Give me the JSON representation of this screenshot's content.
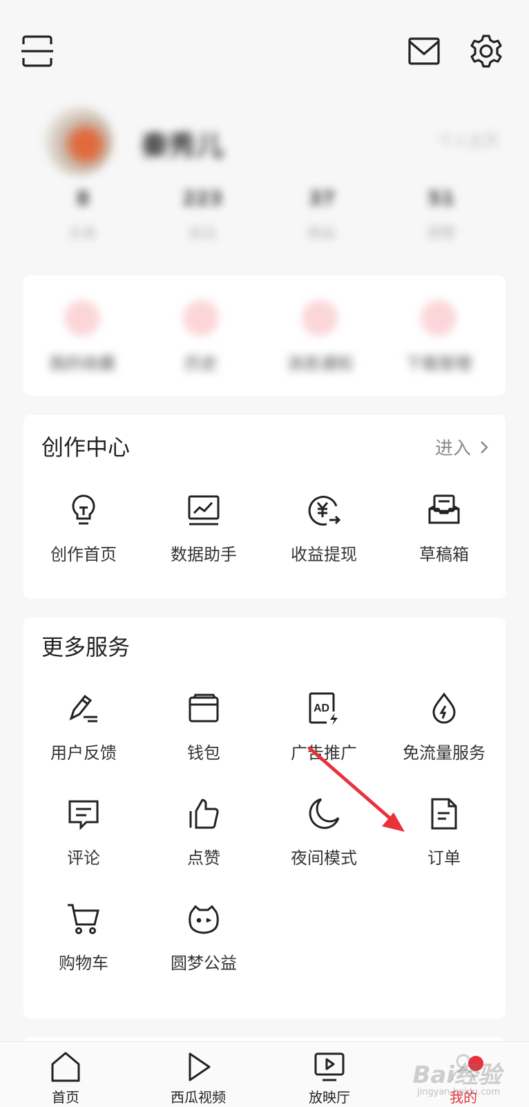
{
  "profile": {
    "name": "秦秀儿",
    "homepage_link": "个人主页",
    "stats": [
      {
        "num": "8",
        "label": "头条"
      },
      {
        "num": "223",
        "label": "关注"
      },
      {
        "num": "37",
        "label": "粉丝"
      },
      {
        "num": "51",
        "label": "获赞"
      }
    ]
  },
  "quick_actions": [
    {
      "label": "我的收藏"
    },
    {
      "label": "历史"
    },
    {
      "label": "消息通知"
    },
    {
      "label": "下载管理"
    }
  ],
  "creation_center": {
    "title": "创作中心",
    "enter_label": "进入",
    "items": [
      {
        "label": "创作首页",
        "icon": "lightbulb-icon"
      },
      {
        "label": "数据助手",
        "icon": "chart-monitor-icon"
      },
      {
        "label": "收益提现",
        "icon": "yuan-withdraw-icon"
      },
      {
        "label": "草稿箱",
        "icon": "drafts-box-icon"
      }
    ]
  },
  "more_services": {
    "title": "更多服务",
    "items": [
      {
        "label": "用户反馈",
        "icon": "pencil-feedback-icon"
      },
      {
        "label": "钱包",
        "icon": "wallet-icon"
      },
      {
        "label": "广告推广",
        "icon": "ad-icon"
      },
      {
        "label": "免流量服务",
        "icon": "water-drop-icon"
      },
      {
        "label": "评论",
        "icon": "comment-icon"
      },
      {
        "label": "点赞",
        "icon": "thumbs-up-icon"
      },
      {
        "label": "夜间模式",
        "icon": "moon-icon"
      },
      {
        "label": "订单",
        "icon": "order-document-icon"
      },
      {
        "label": "购物车",
        "icon": "shopping-cart-icon"
      },
      {
        "label": "圆梦公益",
        "icon": "cat-face-icon"
      }
    ]
  },
  "bottom_nav": [
    {
      "label": "首页",
      "icon": "home-icon"
    },
    {
      "label": "西瓜视频",
      "icon": "play-icon"
    },
    {
      "label": "放映厅",
      "icon": "tv-play-icon"
    },
    {
      "label": "我的",
      "icon": "profile-icon",
      "active": true
    }
  ],
  "watermark": {
    "text": "Bai经验",
    "sub": "jingyan.baidu.com"
  },
  "colors": {
    "accent": "#e8323c",
    "arrow": "#e8323c",
    "background": "#f7f7f7"
  }
}
